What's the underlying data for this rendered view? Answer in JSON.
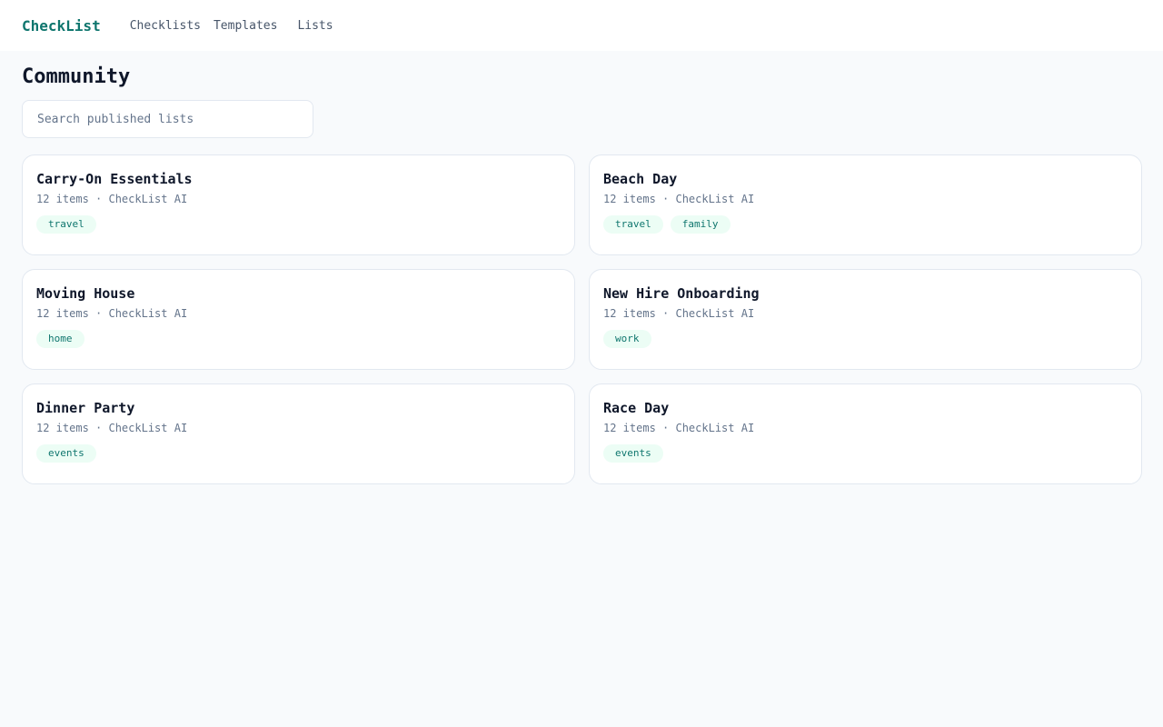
{
  "app": {
    "brand": "CheckList"
  },
  "nav": {
    "items": [
      "Checklists",
      "Templates",
      "Lists"
    ]
  },
  "page": {
    "title": "Community"
  },
  "search": {
    "placeholder": "Search published lists",
    "value": ""
  },
  "cards": [
    {
      "title": "Carry-On Essentials",
      "meta": "12 items · CheckList AI",
      "tags": [
        "travel"
      ]
    },
    {
      "title": "Beach Day",
      "meta": "12 items · CheckList AI",
      "tags": [
        "travel",
        "family"
      ]
    },
    {
      "title": "Moving House",
      "meta": "12 items · CheckList AI",
      "tags": [
        "home"
      ]
    },
    {
      "title": "New Hire Onboarding",
      "meta": "12 items · CheckList AI",
      "tags": [
        "work"
      ]
    },
    {
      "title": "Dinner Party",
      "meta": "12 items · CheckList AI",
      "tags": [
        "events"
      ]
    },
    {
      "title": "Race Day",
      "meta": "12 items · CheckList AI",
      "tags": [
        "events"
      ]
    }
  ],
  "colors": {
    "brand": "#0f766e",
    "background": "#f8fafc",
    "tag_bg": "#ecfdf5",
    "muted_text": "#64748b"
  }
}
